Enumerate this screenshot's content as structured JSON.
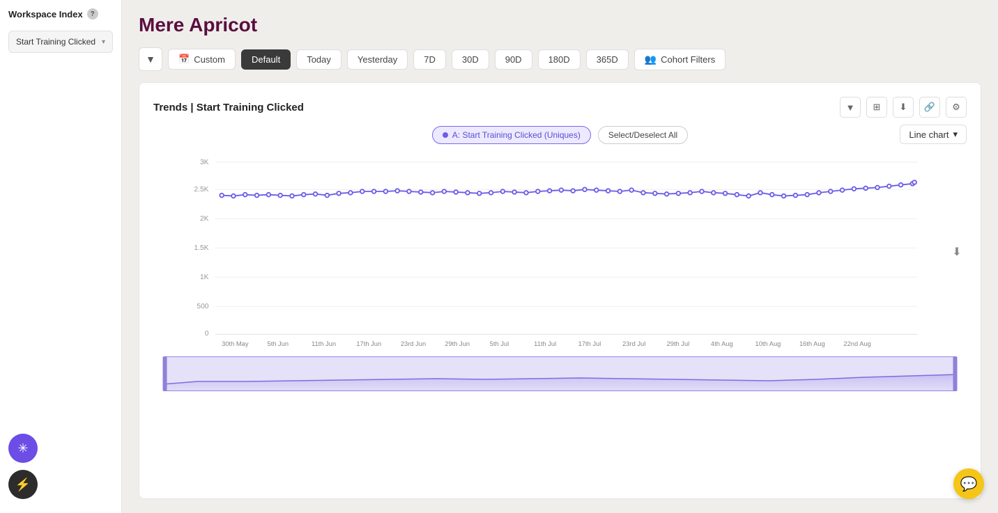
{
  "sidebar": {
    "title": "Workspace Index",
    "help_label": "?",
    "nav_item": {
      "label": "Start Training Clicked",
      "chevron": "▾"
    },
    "icons": [
      {
        "id": "star-icon",
        "symbol": "✳",
        "style": "purple"
      },
      {
        "id": "bolt-icon",
        "symbol": "⚡",
        "style": "dark"
      }
    ]
  },
  "page": {
    "title": "Mere Apricot"
  },
  "filter_bar": {
    "filter_icon": "▼",
    "custom_label": "Custom",
    "calendar_icon": "📅",
    "buttons": [
      {
        "id": "default",
        "label": "Default",
        "active": true
      },
      {
        "id": "today",
        "label": "Today",
        "active": false
      },
      {
        "id": "yesterday",
        "label": "Yesterday",
        "active": false
      },
      {
        "id": "7d",
        "label": "7D",
        "active": false
      },
      {
        "id": "30d",
        "label": "30D",
        "active": false
      },
      {
        "id": "90d",
        "label": "90D",
        "active": false
      },
      {
        "id": "180d",
        "label": "180D",
        "active": false
      },
      {
        "id": "365d",
        "label": "365D",
        "active": false
      }
    ],
    "cohort_btn": {
      "icon": "👥",
      "label": "Cohort Filters"
    }
  },
  "chart": {
    "title": "Trends | Start Training Clicked",
    "chart_type": "Line chart",
    "legend_item": "A: Start Training Clicked (Uniques)",
    "select_all_label": "Select/Deselect All",
    "y_labels": [
      "3K",
      "2.5K",
      "2K",
      "1.5K",
      "1K",
      "500",
      "0"
    ],
    "x_labels": [
      "30th May",
      "5th Jun",
      "11th Jun",
      "17th Jun",
      "23rd Jun",
      "29th Jun",
      "5th Jul",
      "11th Jul",
      "17th Jul",
      "23rd Jul",
      "29th Jul",
      "4th Aug",
      "10th Aug",
      "16th Aug",
      "22nd Aug"
    ],
    "download_icon": "⬇",
    "action_icons": [
      "▼",
      "⊞",
      "⬇",
      "🔗",
      "⚙"
    ]
  },
  "chat": {
    "icon": "💬"
  }
}
